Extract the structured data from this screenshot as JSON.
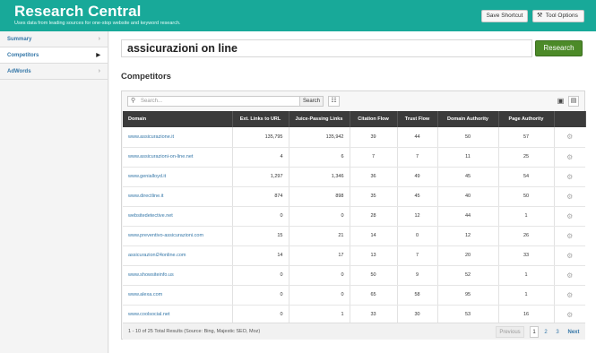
{
  "header": {
    "title": "Research Central",
    "subtitle": "Uses data from leading sources for one-stop website and keyword research.",
    "save_shortcut": "Save Shortcut",
    "tool_options": "Tool Options"
  },
  "sidebar": {
    "items": [
      {
        "label": "Summary"
      },
      {
        "label": "Competitors"
      },
      {
        "label": "AdWords"
      }
    ]
  },
  "main": {
    "query": "assicurazioni on line",
    "research_button": "Research",
    "section_title": "Competitors"
  },
  "table": {
    "search_placeholder": "Search...",
    "search_button": "Search",
    "columns": [
      "Domain",
      "Ext. Links to URL",
      "Juice-Passing Links",
      "Citation Flow",
      "Trust Flow",
      "Domain Authority",
      "Page Authority"
    ],
    "rows": [
      {
        "domain": "www.assicurazione.it",
        "ext": "135,795",
        "juice": "135,942",
        "cf": "39",
        "tf": "44",
        "da": "50",
        "pa": "57"
      },
      {
        "domain": "www.assicurazioni-on-line.net",
        "ext": "4",
        "juice": "6",
        "cf": "7",
        "tf": "7",
        "da": "11",
        "pa": "25"
      },
      {
        "domain": "www.genialloyd.it",
        "ext": "1,297",
        "juice": "1,346",
        "cf": "36",
        "tf": "49",
        "da": "45",
        "pa": "54"
      },
      {
        "domain": "www.directline.it",
        "ext": "874",
        "juice": "898",
        "cf": "35",
        "tf": "45",
        "da": "40",
        "pa": "50"
      },
      {
        "domain": "websitedetective.net",
        "ext": "0",
        "juice": "0",
        "cf": "28",
        "tf": "12",
        "da": "44",
        "pa": "1"
      },
      {
        "domain": "www.preventivo-assicurazioni.com",
        "ext": "15",
        "juice": "21",
        "cf": "14",
        "tf": "0",
        "da": "12",
        "pa": "26"
      },
      {
        "domain": "assicurazioni24online.com",
        "ext": "14",
        "juice": "17",
        "cf": "13",
        "tf": "7",
        "da": "20",
        "pa": "33"
      },
      {
        "domain": "www.showsiteinfo.us",
        "ext": "0",
        "juice": "0",
        "cf": "50",
        "tf": "9",
        "da": "52",
        "pa": "1"
      },
      {
        "domain": "www.alexa.com",
        "ext": "0",
        "juice": "0",
        "cf": "65",
        "tf": "58",
        "da": "95",
        "pa": "1"
      },
      {
        "domain": "www.coolsocial.net",
        "ext": "0",
        "juice": "1",
        "cf": "33",
        "tf": "30",
        "da": "53",
        "pa": "16"
      }
    ],
    "footer_info": "1 - 10 of 25 Total Results (Source: Bing, Majestic SEO, Moz)",
    "pagination": {
      "previous": "Previous",
      "pages": [
        "1",
        "2",
        "3"
      ],
      "next": "Next"
    }
  },
  "icons": {
    "search": "search-icon",
    "columns": "columns-icon",
    "monitor": "monitor-icon",
    "export": "export-icon",
    "gear": "gear-icon",
    "wrench": "wrench-icon"
  },
  "colors": {
    "header": "#18a999",
    "research_button": "#4c8a28",
    "link": "#3577a8",
    "table_header": "#3b3b3b"
  }
}
